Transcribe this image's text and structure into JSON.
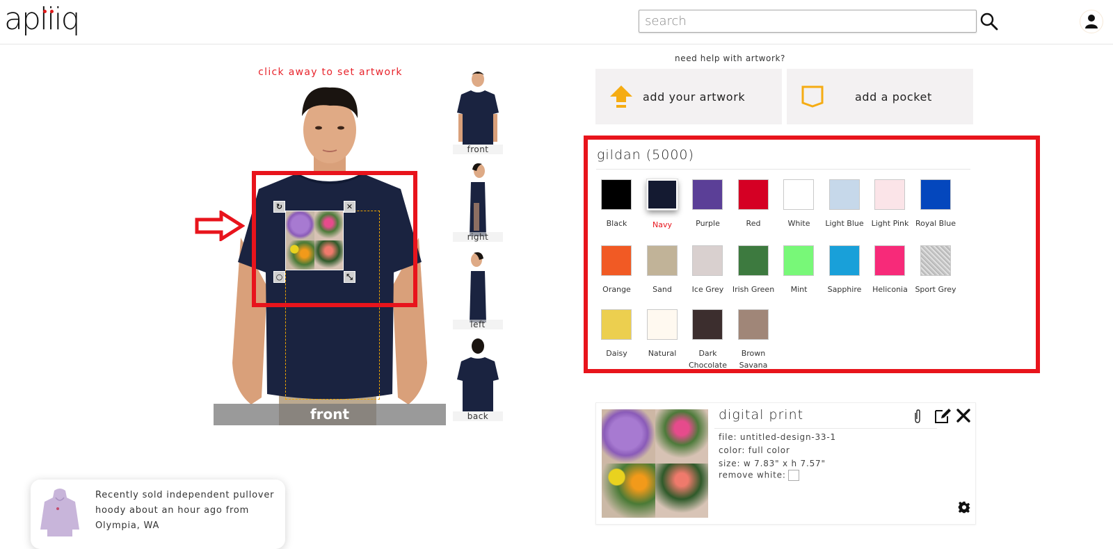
{
  "header": {
    "logo": "apliiq",
    "search_placeholder": "search",
    "search_value": "",
    "search_icon": "magnifier-icon",
    "account_icon": "user-icon"
  },
  "designer": {
    "hint": "click away to set artwork",
    "current_view_label": "front",
    "views": [
      {
        "label": "front"
      },
      {
        "label": "right"
      },
      {
        "label": "left"
      },
      {
        "label": "back"
      }
    ],
    "garment_color": "#1a2340",
    "handles": {
      "rotate": "↻",
      "delete": "✕",
      "reset": "○",
      "resize": "⤡"
    }
  },
  "tools": {
    "help_link": "need help with artwork?",
    "add_artwork": "add your artwork",
    "add_pocket": "add a pocket",
    "accent_color": "#f5ac13"
  },
  "product": {
    "title": "gildan  (5000)",
    "selected_color": "Navy",
    "colors": [
      {
        "name": "Black",
        "hex": "#000000"
      },
      {
        "name": "Navy",
        "hex": "#141a31"
      },
      {
        "name": "Purple",
        "hex": "#5b3f97"
      },
      {
        "name": "Red",
        "hex": "#d50024"
      },
      {
        "name": "White",
        "hex": "#ffffff"
      },
      {
        "name": "Light Blue",
        "hex": "#c6d8ea"
      },
      {
        "name": "Light Pink",
        "hex": "#fbe4e8"
      },
      {
        "name": "Royal Blue",
        "hex": "#0447bd"
      },
      {
        "name": "Orange",
        "hex": "#f15a24"
      },
      {
        "name": "Sand",
        "hex": "#c1b398"
      },
      {
        "name": "Ice Grey",
        "hex": "#d9d0cf"
      },
      {
        "name": "Irish Green",
        "hex": "#3d7a3f"
      },
      {
        "name": "Mint",
        "hex": "#78f878"
      },
      {
        "name": "Sapphire",
        "hex": "#19a0d9"
      },
      {
        "name": "Heliconia",
        "hex": "#f72a79"
      },
      {
        "name": "Sport Grey",
        "hex": "#bdbdbd"
      },
      {
        "name": "Daisy",
        "hex": "#eccf4f"
      },
      {
        "name": "Natural",
        "hex": "#fff9f0"
      },
      {
        "name": "Dark Chocolate",
        "hex": "#3c2e2e"
      },
      {
        "name": "Brown Savana",
        "hex": "#a08678"
      }
    ]
  },
  "design": {
    "title": "digital print",
    "file_label": "file:  untitled-design-33-1",
    "color_label": "color:  full color",
    "size_label": "size: w 7.83\" x h 7.57\"",
    "remove_white_label": "remove white:",
    "remove_white_checked": false
  },
  "toast": {
    "text": "Recently sold independent pullover hoody about an hour ago from Olympia, WA"
  }
}
